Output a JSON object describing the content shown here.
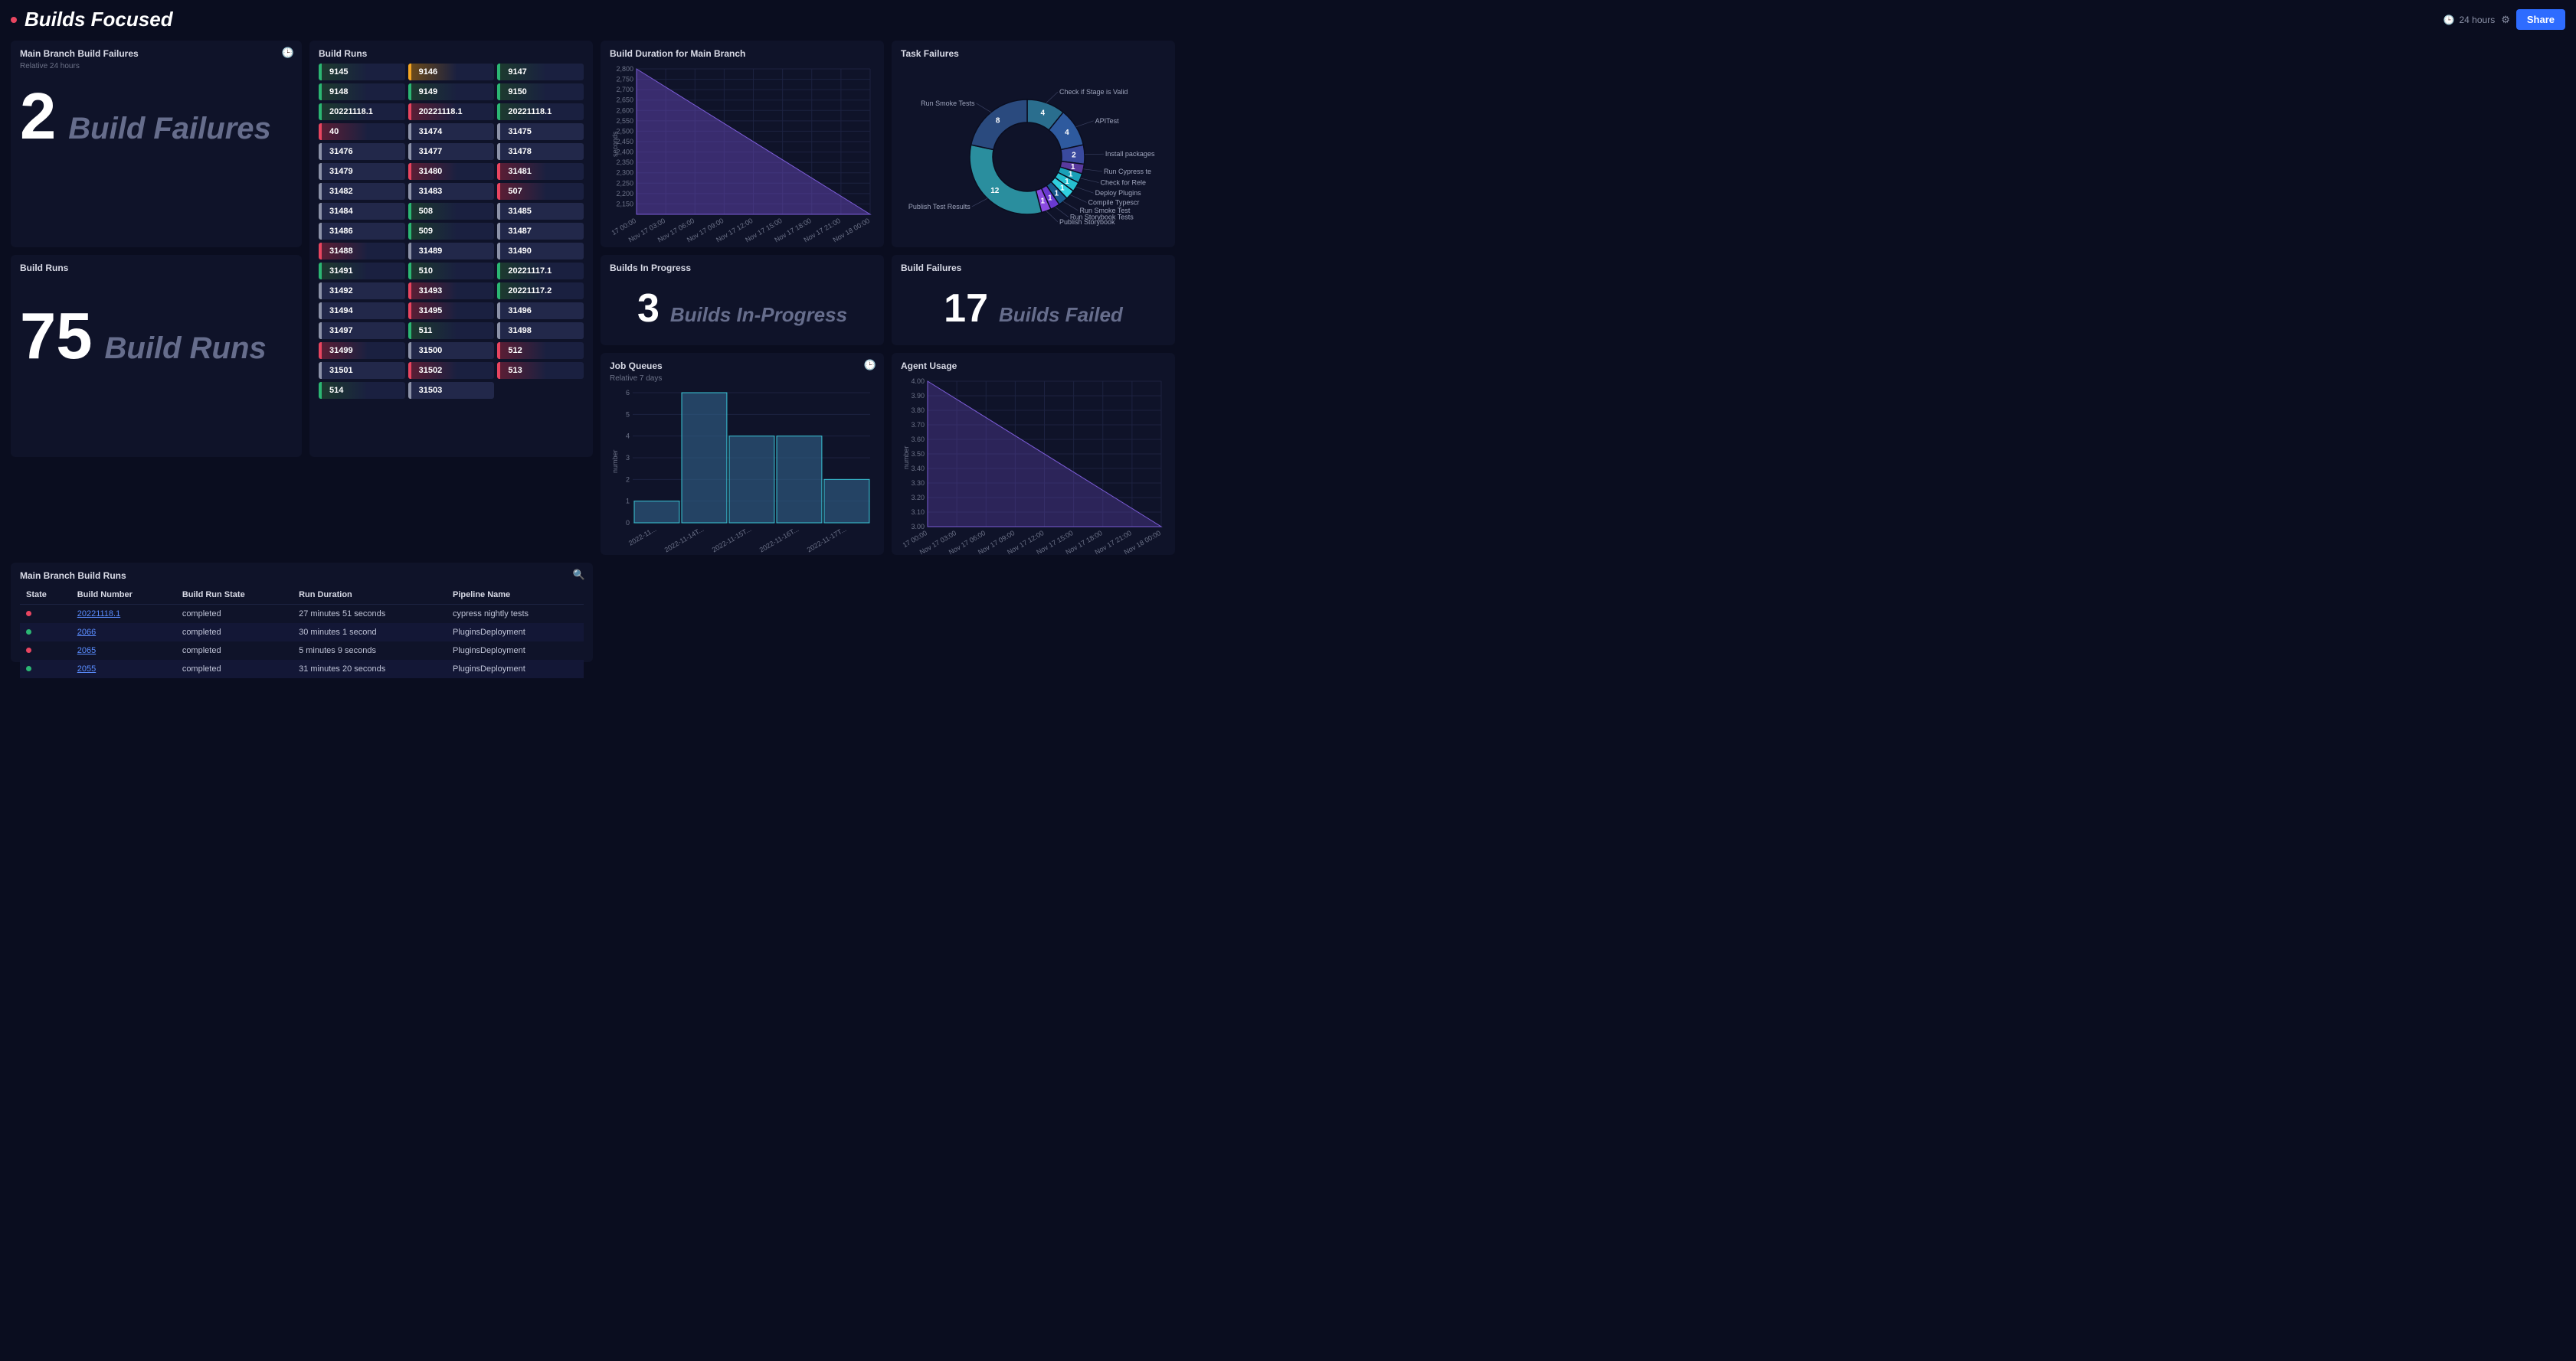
{
  "header": {
    "title": "Builds Focused",
    "time_range": "24 hours",
    "share_label": "Share"
  },
  "panels": {
    "build_failures": {
      "title": "Main Branch Build Failures",
      "subtitle": "Relative 24 hours",
      "value": "2",
      "label": "Build Failures"
    },
    "build_runs_count": {
      "title": "Build Runs",
      "value": "75",
      "label": "Build Runs"
    },
    "build_runs_grid": {
      "title": "Build Runs",
      "items": [
        {
          "id": "9145",
          "s": "green"
        },
        {
          "id": "9146",
          "s": "orange"
        },
        {
          "id": "9147",
          "s": "green"
        },
        {
          "id": "9148",
          "s": "green"
        },
        {
          "id": "9149",
          "s": "green"
        },
        {
          "id": "9150",
          "s": "green"
        },
        {
          "id": "20221118.1",
          "s": "green"
        },
        {
          "id": "20221118.1",
          "s": "red"
        },
        {
          "id": "20221118.1",
          "s": "green"
        },
        {
          "id": "40",
          "s": "red"
        },
        {
          "id": "31474",
          "s": "gray"
        },
        {
          "id": "31475",
          "s": "gray"
        },
        {
          "id": "31476",
          "s": "gray"
        },
        {
          "id": "31477",
          "s": "gray"
        },
        {
          "id": "31478",
          "s": "gray"
        },
        {
          "id": "31479",
          "s": "gray"
        },
        {
          "id": "31480",
          "s": "red"
        },
        {
          "id": "31481",
          "s": "red"
        },
        {
          "id": "31482",
          "s": "gray"
        },
        {
          "id": "31483",
          "s": "gray"
        },
        {
          "id": "507",
          "s": "red"
        },
        {
          "id": "31484",
          "s": "gray"
        },
        {
          "id": "508",
          "s": "green"
        },
        {
          "id": "31485",
          "s": "gray"
        },
        {
          "id": "31486",
          "s": "gray"
        },
        {
          "id": "509",
          "s": "green"
        },
        {
          "id": "31487",
          "s": "gray"
        },
        {
          "id": "31488",
          "s": "red"
        },
        {
          "id": "31489",
          "s": "gray"
        },
        {
          "id": "31490",
          "s": "gray"
        },
        {
          "id": "31491",
          "s": "green"
        },
        {
          "id": "510",
          "s": "green"
        },
        {
          "id": "20221117.1",
          "s": "green"
        },
        {
          "id": "31492",
          "s": "gray"
        },
        {
          "id": "31493",
          "s": "red"
        },
        {
          "id": "20221117.2",
          "s": "green"
        },
        {
          "id": "31494",
          "s": "gray"
        },
        {
          "id": "31495",
          "s": "red"
        },
        {
          "id": "31496",
          "s": "gray"
        },
        {
          "id": "31497",
          "s": "gray"
        },
        {
          "id": "511",
          "s": "green"
        },
        {
          "id": "31498",
          "s": "gray"
        },
        {
          "id": "31499",
          "s": "red"
        },
        {
          "id": "31500",
          "s": "gray"
        },
        {
          "id": "512",
          "s": "red"
        },
        {
          "id": "31501",
          "s": "gray"
        },
        {
          "id": "31502",
          "s": "red"
        },
        {
          "id": "513",
          "s": "red"
        },
        {
          "id": "514",
          "s": "green"
        },
        {
          "id": "31503",
          "s": "gray"
        }
      ]
    },
    "build_duration": {
      "title": "Build Duration for Main Branch"
    },
    "task_failures": {
      "title": "Task Failures"
    },
    "builds_in_progress": {
      "title": "Builds In Progress",
      "value": "3",
      "label": "Builds In-Progress"
    },
    "build_failures_17": {
      "title": "Build Failures",
      "value": "17",
      "label": "Builds Failed"
    },
    "job_queues": {
      "title": "Job Queues",
      "subtitle": "Relative 7 days"
    },
    "agent_usage": {
      "title": "Agent Usage"
    },
    "main_branch_runs": {
      "title": "Main Branch Build Runs",
      "columns": [
        "State",
        "Build Number",
        "Build Run State",
        "Run Duration",
        "Pipeline Name"
      ],
      "rows": [
        {
          "state": "red",
          "num": "20221118.1",
          "run": "completed",
          "dur": "27 minutes 51 seconds",
          "pipe": "cypress nightly tests"
        },
        {
          "state": "green",
          "num": "2066",
          "run": "completed",
          "dur": "30 minutes 1 second",
          "pipe": "PluginsDeployment"
        },
        {
          "state": "red",
          "num": "2065",
          "run": "completed",
          "dur": "5 minutes 9 seconds",
          "pipe": "PluginsDeployment"
        },
        {
          "state": "green",
          "num": "2055",
          "run": "completed",
          "dur": "31 minutes 20 seconds",
          "pipe": "PluginsDeployment"
        }
      ]
    }
  },
  "chart_data": [
    {
      "id": "build_duration",
      "type": "area",
      "title": "Build Duration for Main Branch",
      "ylabel": "seconds",
      "x": [
        "17 00:00",
        "Nov 17 03:00",
        "Nov 17 06:00",
        "Nov 17 09:00",
        "Nov 17 12:00",
        "Nov 17 15:00",
        "Nov 17 18:00",
        "Nov 17 21:00",
        "Nov 18 00:00"
      ],
      "ylim": [
        2100,
        2800
      ],
      "y_ticks": [
        2150,
        2200,
        2250,
        2300,
        2350,
        2400,
        2450,
        2500,
        2550,
        2600,
        2650,
        2700,
        2750,
        2800
      ],
      "values": [
        2800,
        2100
      ]
    },
    {
      "id": "task_failures",
      "type": "pie",
      "title": "Task Failures",
      "series": [
        {
          "name": "Check if Stage is Valid",
          "value": 4
        },
        {
          "name": "APITest",
          "value": 4
        },
        {
          "name": "Install packages",
          "value": 2
        },
        {
          "name": "Run Cypress te",
          "value": 1
        },
        {
          "name": "Check for Rele",
          "value": 1
        },
        {
          "name": "Deploy Plugins",
          "value": 1
        },
        {
          "name": "Compile Typescr",
          "value": 1
        },
        {
          "name": "Run Smoke Test",
          "value": 1
        },
        {
          "name": "Run Storybook Tests",
          "value": 1
        },
        {
          "name": "Publish Storybook",
          "value": 1
        },
        {
          "name": "Publish Test Results",
          "value": 12
        },
        {
          "name": "Run Smoke Tests",
          "value": 8
        }
      ]
    },
    {
      "id": "job_queues",
      "type": "bar",
      "title": "Job Queues",
      "ylabel": "number",
      "categories": [
        "2022-11...",
        "2022-11-14T...",
        "2022-11-15T...",
        "2022-11-16T...",
        "2022-11-17T..."
      ],
      "values": [
        1,
        6,
        4,
        4,
        2
      ],
      "ylim": [
        0,
        6
      ]
    },
    {
      "id": "agent_usage",
      "type": "area",
      "title": "Agent Usage",
      "ylabel": "number",
      "x": [
        "17 00:00",
        "Nov 17 03:00",
        "Nov 17 06:00",
        "Nov 17 09:00",
        "Nov 17 12:00",
        "Nov 17 15:00",
        "Nov 17 18:00",
        "Nov 17 21:00",
        "Nov 18 00:00"
      ],
      "ylim": [
        3.0,
        4.0
      ],
      "y_ticks": [
        3.0,
        3.1,
        3.2,
        3.3,
        3.4,
        3.5,
        3.6,
        3.7,
        3.8,
        3.9,
        4.0
      ],
      "values": [
        4.0,
        3.0
      ]
    }
  ]
}
